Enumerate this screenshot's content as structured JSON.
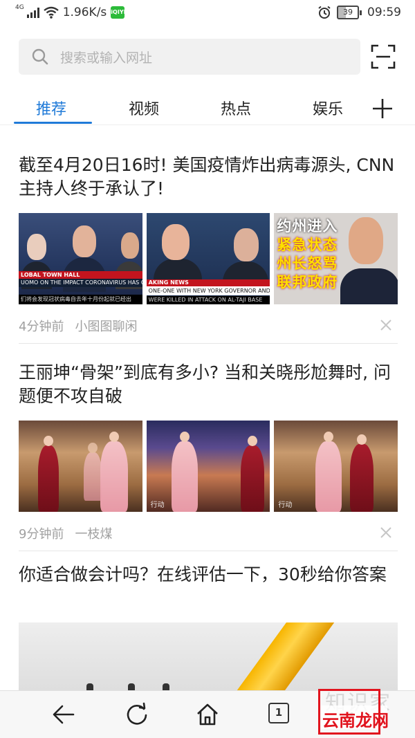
{
  "status_bar": {
    "network_type": "4G",
    "speed": "1.96K/s",
    "app_icon_label": "iQIYI",
    "battery": "39",
    "time": "09:59"
  },
  "search": {
    "placeholder": "搜索或输入网址"
  },
  "tabs": [
    {
      "label": "推荐",
      "active": true
    },
    {
      "label": "视频",
      "active": false
    },
    {
      "label": "热点",
      "active": false
    },
    {
      "label": "娱乐",
      "active": false
    }
  ],
  "articles": [
    {
      "title": "截至4月20日16时! 美国疫情炸出病毒源头, CNN主持人终于承认了!",
      "time": "4分钟前",
      "source": "小图图聊闲",
      "thumbs": {
        "t1_ticker1": "LOBAL TOWN HALL",
        "t1_ticker2": "UOMO ON THE IMPACT CORONAVIRUS HAS ON HIS FAMILY",
        "t1_ticker3": "们将会发现冠状病毒自去年十月份起就已经出",
        "t2_ticker1": "AKING NEWS",
        "t2_ticker2": "ONE-ONE WITH NEW YORK GOVERNOR ANDREW CUOMO",
        "t2_ticker3": "WERE KILLED IN ATTACK ON AL-TAJI BASE",
        "t3_caption1": "约州进入",
        "t3_caption2": "紧急状态",
        "t3_caption3": "州长怒骂",
        "t3_caption4": "联邦政府"
      }
    },
    {
      "title": "王丽坤“骨架”到底有多小? 当和关晓彤尬舞时, 问题便不攻自破",
      "time": "9分钟前",
      "source": "一枝煤",
      "thumbs": {
        "t2_watermark": "行动",
        "t3_watermark": "行动"
      }
    },
    {
      "title": "你适合做会计吗？在线评估一下，30秒给你答案"
    }
  ],
  "bottom_bar": {
    "tab_count": "1",
    "watermark_text": "知识家",
    "overlay_label": "云南龙网"
  },
  "colors": {
    "accent": "#1f7ad8",
    "overlay_red": "#e1141e"
  }
}
